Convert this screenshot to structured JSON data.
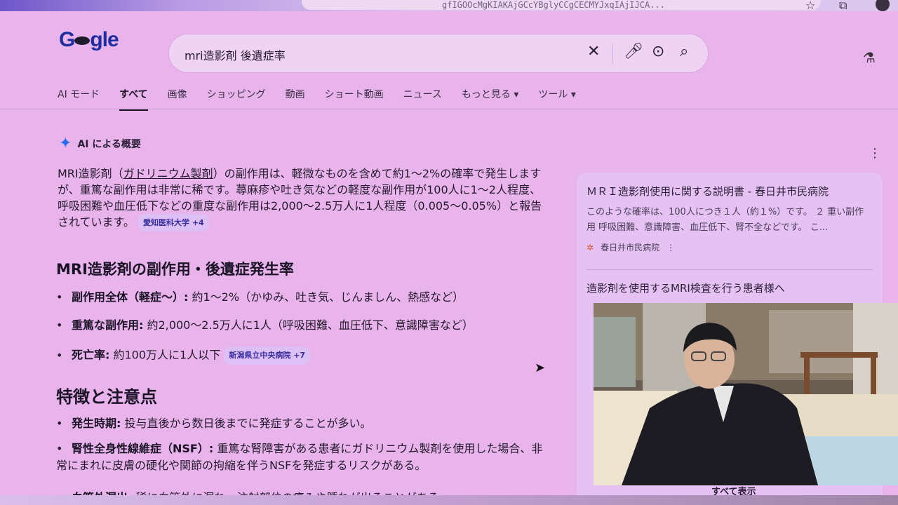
{
  "browser": {
    "url_fragment": "gfIGOOcMgKIAKAjGCcYBglyCCgCECMYJxqIAjIJCA...",
    "star_icon": "star-icon",
    "extension_icon": "puzzle-icon"
  },
  "google": {
    "logo_text": "Google",
    "search": {
      "query": "mri造影剤 後遺症率",
      "clear_icon": "close-icon",
      "mic_icon": "mic-icon",
      "lens_icon": "camera-icon",
      "search_icon": "search-icon"
    },
    "labs_icon": "flask-icon"
  },
  "tabs": [
    {
      "label": "AI モード"
    },
    {
      "label": "すべて",
      "active": true
    },
    {
      "label": "画像"
    },
    {
      "label": "ショッピング"
    },
    {
      "label": "動画"
    },
    {
      "label": "ショート動画"
    },
    {
      "label": "ニュース"
    },
    {
      "label": "もっと見る ▾"
    },
    {
      "label": "ツール ▾"
    }
  ],
  "ai_overview": {
    "heading": "AI による概要",
    "summary": {
      "p1_a": "MRI造影剤（",
      "p1_link": "ガドリニウム製剤",
      "p1_b": "）の副作用は、軽微なものを含めて約1〜2%の確率で発生しますが、重篤な副作用は非常に稀です。蕁麻疹や吐き気などの軽度な副作用が100人に1〜2人程度、呼吸困難や血圧低下などの重度な副作用は2,000〜2.5万人に1人程度（0.005〜0.05%）と報告されています。",
      "chip": "愛知医科大学 +4"
    },
    "section1": {
      "title": "MRI造影剤の副作用・後遺症発生率",
      "items": [
        {
          "label": "副作用全体（軽症〜）:",
          "text": "約1〜2%（かゆみ、吐き気、じんましん、熱感など）"
        },
        {
          "label": "重篤な副作用:",
          "text": "約2,000〜2.5万人に1人（呼吸困難、血圧低下、意識障害など）"
        },
        {
          "label": "死亡率:",
          "text": "約100万人に1人以下",
          "chip": "新潟県立中央病院 +7"
        }
      ]
    },
    "section2": {
      "title": "特徴と注意点",
      "items": [
        {
          "label": "発生時期:",
          "text": "投与直後から数日後までに発症することが多い。"
        },
        {
          "label": "腎性全身性線維症（NSF）:",
          "text": "重篤な腎障害がある患者にガドリニウム製剤を使用した場合、非常にまれに皮膚の硬化や関節の拘縮を伴うNSFを発症するリスクがある。"
        },
        {
          "label": "血管外漏出:",
          "text": "稀に血管外に漏れ、注射部位の痛みや腫れが出ることがある。"
        }
      ]
    }
  },
  "sources": {
    "card1": {
      "title": "ＭＲＩ造影剤使用に関する説明書 - 春日井市民病院",
      "snippet": "このような確率は、100人につき１人（約１%）です。 ２ 重い副作用 呼吸困難、意識障害、血圧低下、腎不全などです。 こ...",
      "site": "春日井市民病院"
    },
    "card2": {
      "title": "造影剤を使用するMRI検査を行う患者様へ"
    },
    "show_all": "すべて表示"
  }
}
